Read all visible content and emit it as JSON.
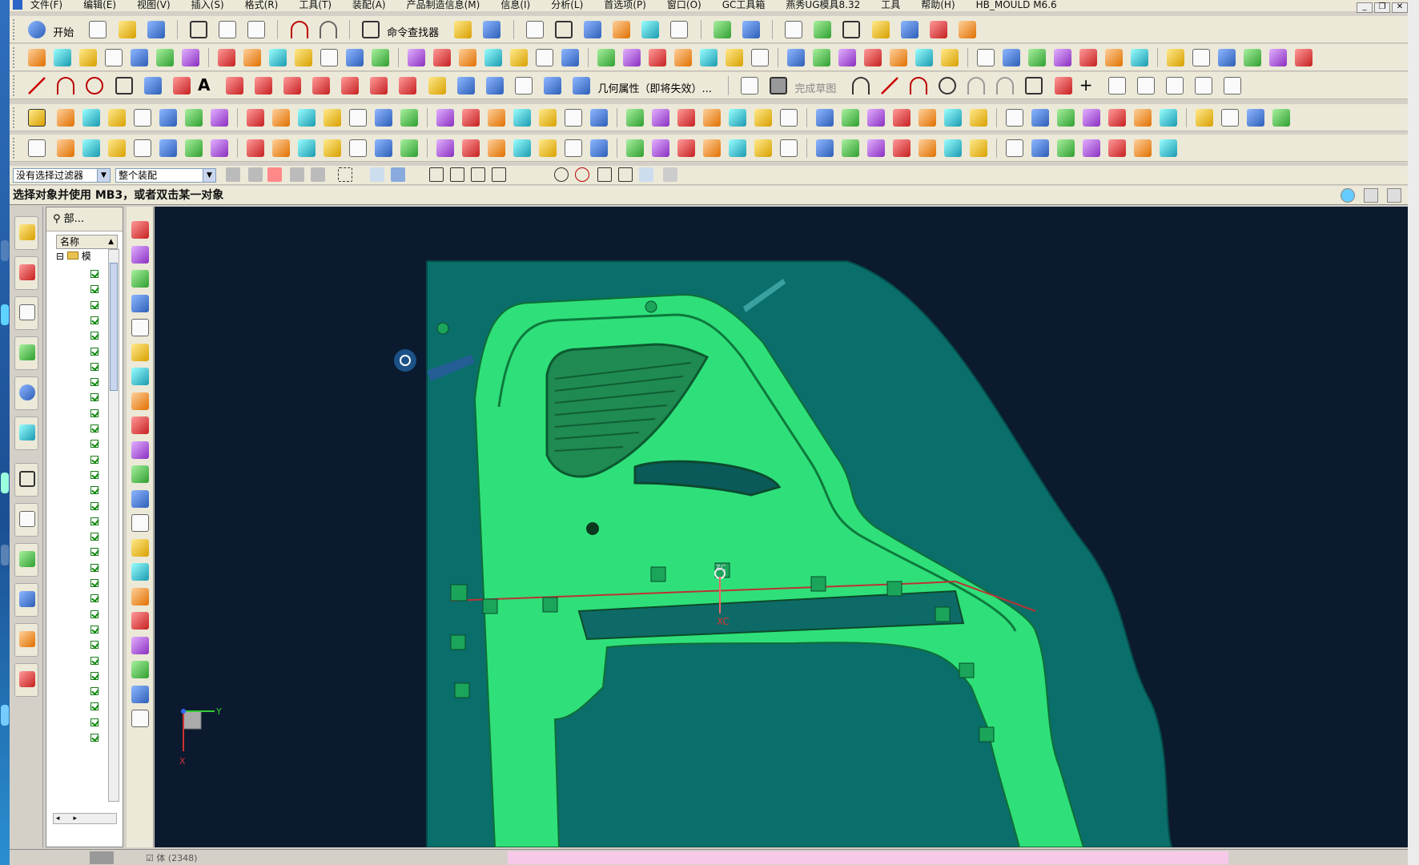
{
  "menu": {
    "items": [
      "文件(F)",
      "编辑(E)",
      "视图(V)",
      "插入(S)",
      "格式(R)",
      "工具(T)",
      "装配(A)",
      "产品制造信息(M)",
      "信息(I)",
      "分析(L)",
      "首选项(P)",
      "窗口(O)",
      "GC工具箱",
      "燕秀UG模具8.32",
      "工具",
      "帮助(H)",
      "HB_MOULD M6.6"
    ]
  },
  "toolbar": {
    "start_label": "开始",
    "command_finder_label": "命令查找器",
    "geom_attr_label": "几何属性（即将失效）...",
    "finish_sketch_label": "完成草图"
  },
  "selection": {
    "filter_value": "没有选择过滤器",
    "scope_value": "整个装配"
  },
  "status": {
    "prompt": "选择对象并使用 MB3，或者双击某一对象"
  },
  "navigator": {
    "title": "部...",
    "column_name": "名称",
    "root_label": "模"
  },
  "viewport": {
    "triad_x": "X",
    "triad_y": "Y",
    "wcs_xc": "XC",
    "wcs_zc": "ZC"
  },
  "bottom": {
    "item_label": "体 (2348)"
  },
  "colors": {
    "part_green": "#2fe07a",
    "background_teal": "#0a6e6a",
    "viewport_bg": "#0b1a2e"
  }
}
